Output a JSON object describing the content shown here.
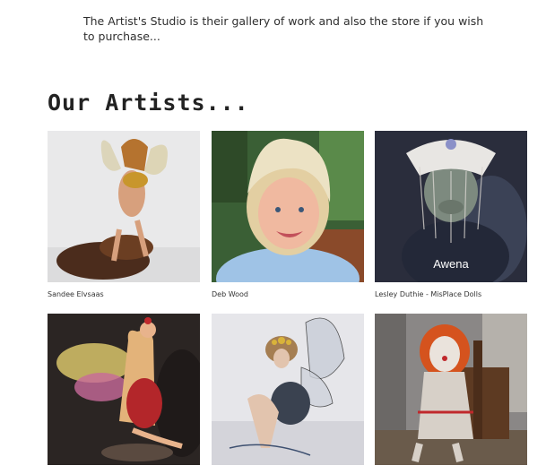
{
  "intro": {
    "text": "The Artist's Studio is their gallery of work and also the store if you wish to purchase..."
  },
  "section": {
    "title": "Our Artists..."
  },
  "artists": [
    {
      "name": "Sandee Elvsaas"
    },
    {
      "name": "Deb Wood"
    },
    {
      "name": "Lesley Duthie - MisPlace Dolls",
      "overlay": "Awena"
    },
    {
      "name": ""
    },
    {
      "name": ""
    },
    {
      "name": ""
    }
  ]
}
